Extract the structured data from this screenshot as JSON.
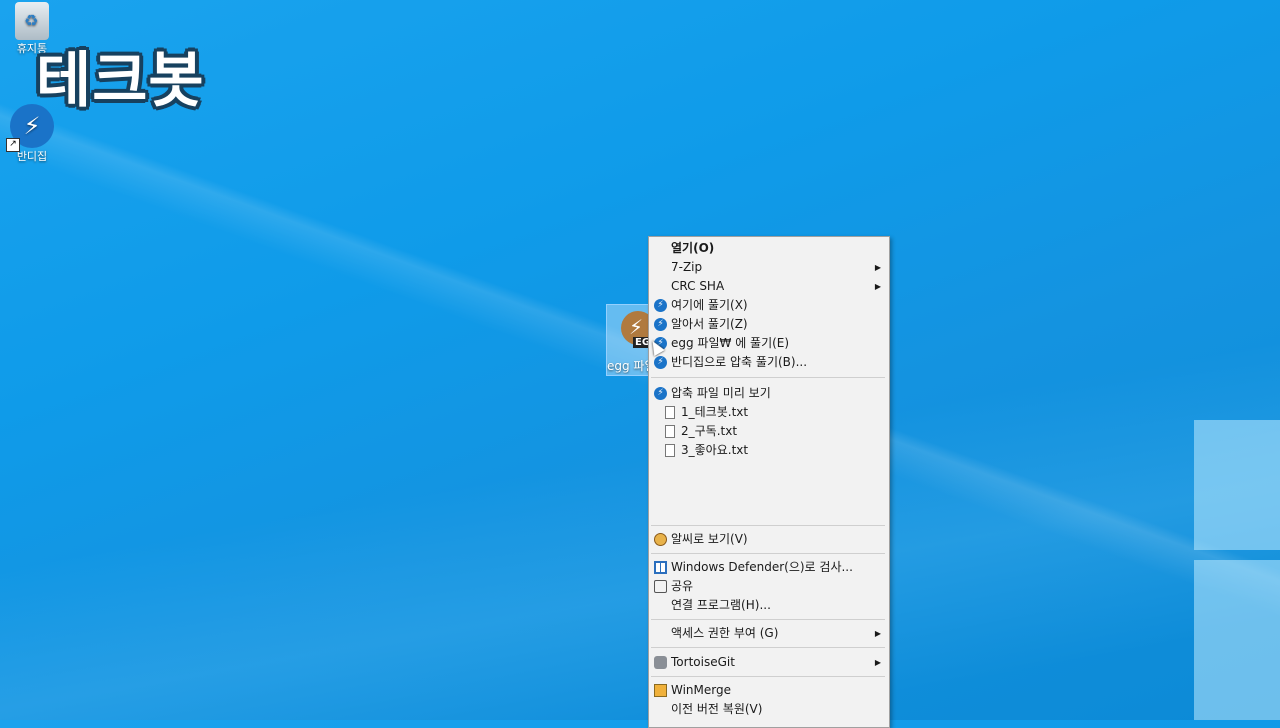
{
  "desktop": {
    "watermark": "테크봇",
    "icons": [
      {
        "label": "휴지통"
      },
      {
        "label": "반디집"
      }
    ],
    "file": {
      "badge": "EG",
      "name": "egg 파일"
    }
  },
  "context_menu": {
    "items": [
      {
        "label": "열기(O)",
        "bold": true
      },
      {
        "label": "7-Zip",
        "submenu": true
      },
      {
        "label": "CRC SHA",
        "submenu": true
      },
      {
        "label": "여기에 풀기(X)",
        "icon": "bandizip-icon"
      },
      {
        "label": "알아서 풀기(Z)",
        "icon": "bandizip-icon"
      },
      {
        "label": "egg 파일₩ 에 풀기(E)",
        "icon": "bandizip-icon"
      },
      {
        "label": "반디집으로 압축 풀기(B)...",
        "icon": "bandizip-icon"
      },
      {
        "label": "압축 파일 미리 보기",
        "icon": "bandizip-icon"
      },
      {
        "label": "1_테크봇.txt",
        "icon": "text-file-icon"
      },
      {
        "label": "2_구독.txt",
        "icon": "text-file-icon"
      },
      {
        "label": "3_좋아요.txt",
        "icon": "text-file-icon"
      },
      {
        "label": "알씨로 보기(V)",
        "icon": "alsee-icon"
      },
      {
        "label": "Windows Defender(으)로 검사...",
        "icon": "windows-defender-icon"
      },
      {
        "label": "공유",
        "icon": "share-icon"
      },
      {
        "label": "연결 프로그램(H)..."
      },
      {
        "label": "액세스 권한 부여 (G)",
        "submenu": true
      },
      {
        "label": "TortoiseGit",
        "submenu": true,
        "icon": "tortoisegit-icon"
      },
      {
        "label": "WinMerge",
        "icon": "winmerge-icon"
      },
      {
        "label": "이전 버전 복원(V)"
      }
    ]
  }
}
